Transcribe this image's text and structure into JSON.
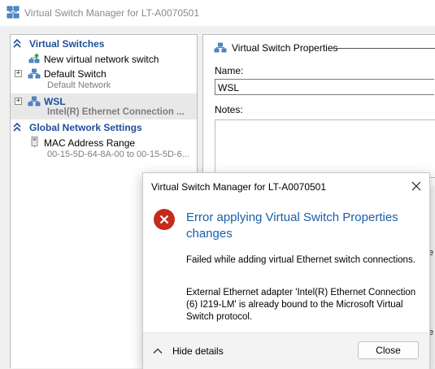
{
  "window": {
    "title": "Virtual Switch Manager for LT-A0070501"
  },
  "sidebar": {
    "virtual_switches_header": "Virtual Switches",
    "new_switch": "New virtual network switch",
    "default_switch": {
      "label": "Default Switch",
      "subtitle": "Default Network"
    },
    "wsl_switch": {
      "label": "WSL",
      "subtitle": "Intel(R) Ethernet Connection ..."
    },
    "global_header": "Global Network Settings",
    "mac_range": {
      "label": "MAC Address Range",
      "subtitle": "00-15-5D-64-8A-00 to 00-15-5D-6..."
    }
  },
  "properties": {
    "title": "Virtual Switch Properties",
    "name_label": "Name:",
    "name_value": "WSL",
    "notes_label": "Notes:",
    "notes_value": "",
    "peek_1": "e",
    "peek_2": "e"
  },
  "dialog": {
    "title": "Virtual Switch Manager for LT-A0070501",
    "heading": "Error applying Virtual Switch Properties changes",
    "message_1": "Failed while adding virtual Ethernet switch connections.",
    "message_2": "External Ethernet adapter 'Intel(R) Ethernet Connection (6) I219-LM' is already bound to the Microsoft Virtual Switch protocol.",
    "hide_details": "Hide details",
    "close_button": "Close"
  },
  "colors": {
    "accent": "#1f4e9b",
    "heading_blue": "#1a5ea8",
    "error_red": "#c42b1c"
  },
  "icons": {
    "app": "virtual-switch-manager-icon",
    "error": "error-x-icon",
    "close": "close-icon",
    "hide_details": "chevron-up-icon"
  }
}
